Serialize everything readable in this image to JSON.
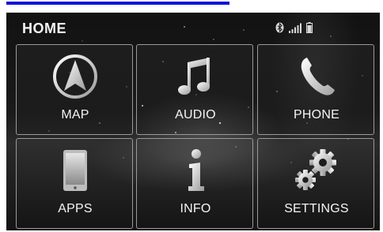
{
  "header": {
    "title": "HOME",
    "status_icons": [
      "bluetooth-icon",
      "signal-strength-icon",
      "battery-icon"
    ]
  },
  "tiles": [
    {
      "label": "MAP",
      "icon": "navigation-arrow-icon"
    },
    {
      "label": "AUDIO",
      "icon": "music-note-icon"
    },
    {
      "label": "PHONE",
      "icon": "phone-handset-icon"
    },
    {
      "label": "APPS",
      "icon": "tablet-icon"
    },
    {
      "label": "INFO",
      "icon": "info-icon"
    },
    {
      "label": "SETTINGS",
      "icon": "gears-icon"
    }
  ],
  "colors": {
    "accent_bar": "#1010e0",
    "screen_background": "#161616",
    "tile_border": "#9a9a9a",
    "text": "#f5f5f5"
  }
}
